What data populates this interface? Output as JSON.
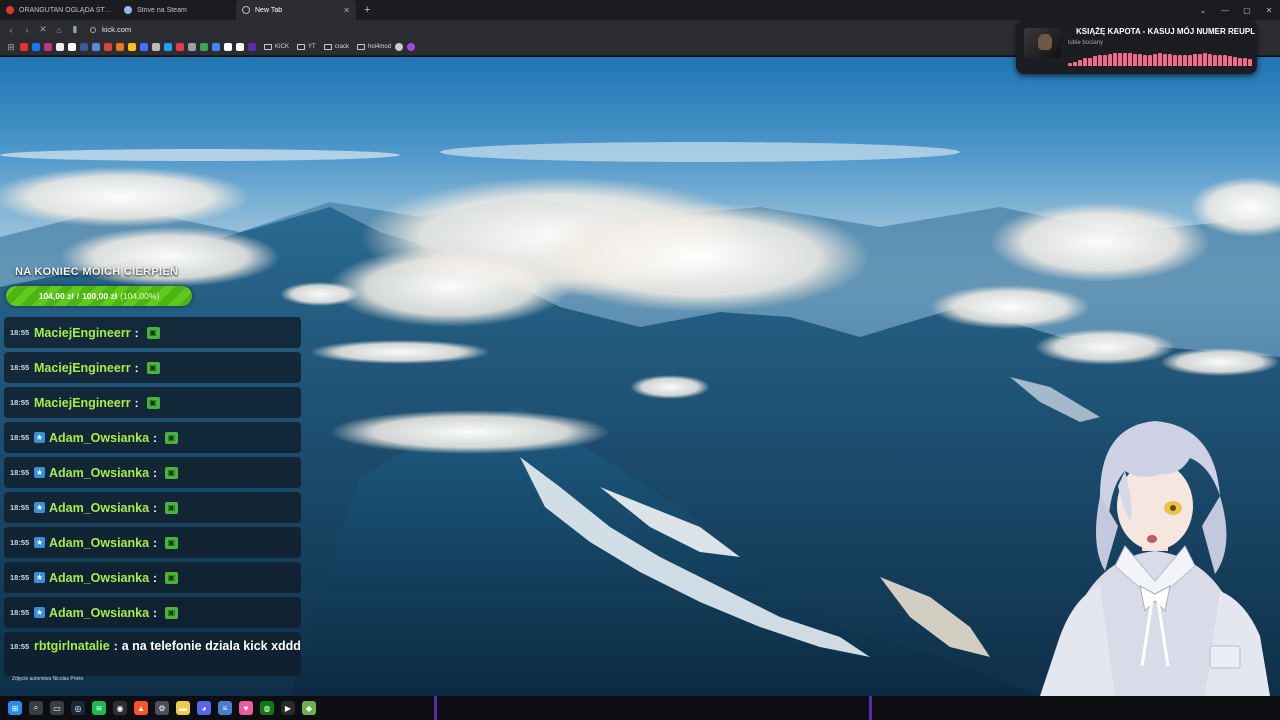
{
  "browser": {
    "tabs": [
      {
        "title": "ORANGUTAN OGLĄDA STARCIE POL",
        "favicon_color": "#e3342f",
        "active": false
      },
      {
        "title": "Strive na Steam",
        "favicon_color": "#8fb8e8",
        "active": false
      },
      {
        "title": "New Tab",
        "favicon_color": "#bbbbbb",
        "active": true
      }
    ],
    "url": "kick.com",
    "bookmark_folders": [
      "KICK",
      "YT",
      "crack",
      "hoi4mod"
    ],
    "bookmark_icon_colors": [
      "#e3342f",
      "#1877f2",
      "#c13584",
      "#eeeeee",
      "#ffffff",
      "#3b5998",
      "#5b8bd8",
      "#d44638",
      "#e87722",
      "#f5c518",
      "#4a6cf7",
      "#bbbbbb",
      "#1da1f2",
      "#e53950",
      "#9aa0a6",
      "#34a853",
      "#4285f4",
      "#ffffff",
      "#ffffff",
      "#5a2aa8"
    ]
  },
  "now_playing": {
    "song": "KSIĄŻĘ KAPOTA - KASUJ MÓJ NUMER REUPL",
    "artist": "lubie bociany",
    "bar_levels": [
      0.2,
      0.3,
      0.45,
      0.55,
      0.6,
      0.7,
      0.75,
      0.8,
      0.85,
      0.9,
      0.92,
      0.95,
      0.9,
      0.88,
      0.85,
      0.8,
      0.82,
      0.85,
      0.9,
      0.88,
      0.85,
      0.8,
      0.75,
      0.78,
      0.8,
      0.85,
      0.88,
      0.9,
      0.85,
      0.8,
      0.78,
      0.75,
      0.7,
      0.65,
      0.6,
      0.55,
      0.5
    ]
  },
  "goal": {
    "title": "NA KONIEC MOICH CIERPIEŃ",
    "current": "104,00 zł",
    "separator": "/",
    "target": "100,00 zł",
    "percent_label": "(104.00%)"
  },
  "chat": [
    {
      "time": "18:55",
      "user": "MaciejEngineerr",
      "badge": false,
      "colon": ":",
      "emote": true,
      "message": ""
    },
    {
      "time": "18:55",
      "user": "MaciejEngineerr",
      "badge": false,
      "colon": ":",
      "emote": true,
      "message": ""
    },
    {
      "time": "18:55",
      "user": "MaciejEngineerr",
      "badge": false,
      "colon": ":",
      "emote": true,
      "message": ""
    },
    {
      "time": "18:55",
      "user": "Adam_Owsianka",
      "badge": true,
      "colon": ":",
      "emote": true,
      "message": ""
    },
    {
      "time": "18:55",
      "user": "Adam_Owsianka",
      "badge": true,
      "colon": ":",
      "emote": true,
      "message": ""
    },
    {
      "time": "18:55",
      "user": "Adam_Owsianka",
      "badge": true,
      "colon": ":",
      "emote": true,
      "message": ""
    },
    {
      "time": "18:55",
      "user": "Adam_Owsianka",
      "badge": true,
      "colon": ":",
      "emote": true,
      "message": ""
    },
    {
      "time": "18:55",
      "user": "Adam_Owsianka",
      "badge": true,
      "colon": ":",
      "emote": true,
      "message": ""
    },
    {
      "time": "18:55",
      "user": "Adam_Owsianka",
      "badge": true,
      "colon": ":",
      "emote": true,
      "message": ""
    },
    {
      "time": "18:55",
      "user": "rbtgirlnatalie",
      "badge": false,
      "colon": ":",
      "emote": false,
      "message": "a na telefonie dziala kick xddd"
    }
  ],
  "credit": "Zdjęcie autorstwa Nicolas Prieto",
  "taskbar": {
    "icons": [
      {
        "name": "windows-start-icon",
        "color": "#2a8cf0"
      },
      {
        "name": "search-icon",
        "color": "#3a3d44"
      },
      {
        "name": "task-view-icon",
        "color": "#3a3d44"
      },
      {
        "name": "steam-icon",
        "color": "#1b2838"
      },
      {
        "name": "spotify-icon",
        "color": "#1db954"
      },
      {
        "name": "obs-icon",
        "color": "#302e31"
      },
      {
        "name": "brave-icon",
        "color": "#fb542b"
      },
      {
        "name": "settings-icon",
        "color": "#4a5060"
      },
      {
        "name": "file-explorer-icon",
        "color": "#f2c94c"
      },
      {
        "name": "discord-icon",
        "color": "#5865f2"
      },
      {
        "name": "notepad-icon",
        "color": "#4a7fd0"
      },
      {
        "name": "paint-icon",
        "color": "#e85d9a"
      },
      {
        "name": "xbox-icon",
        "color": "#107c10"
      },
      {
        "name": "terminal-icon",
        "color": "#2b2b2b"
      },
      {
        "name": "game-icon",
        "color": "#6ab04c"
      }
    ]
  }
}
